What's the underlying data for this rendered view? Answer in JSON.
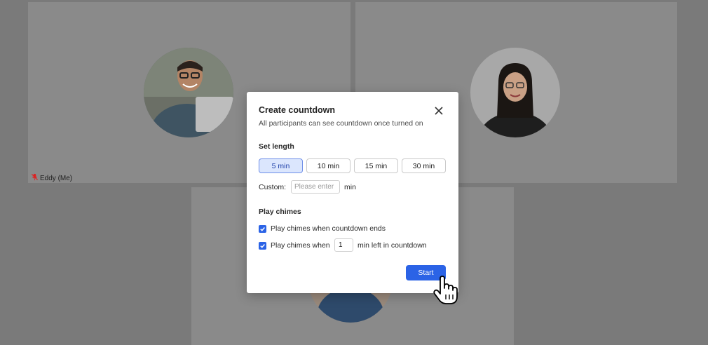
{
  "participants": {
    "self_name": "Eddy (Me)"
  },
  "dialog": {
    "title": "Create countdown",
    "subtitle": "All participants can see countdown once turned on",
    "set_length_label": "Set length",
    "length_options": [
      "5 min",
      "10 min",
      "15 min",
      "30 min"
    ],
    "selected_length": "5 min",
    "custom_label": "Custom:",
    "custom_placeholder": "Please enter",
    "custom_unit": "min",
    "chimes_label": "Play chimes",
    "chime_end_text": "Play chimes when countdown ends",
    "chime_end_checked": true,
    "chime_before_prefix": "Play chimes when",
    "chime_before_value": "1",
    "chime_before_suffix": "min left in countdown",
    "chime_before_checked": true,
    "start_label": "Start"
  },
  "colors": {
    "accent": "#2b63e6",
    "selected_bg": "#dbe6fd",
    "backdrop": "#7a7a7a"
  }
}
